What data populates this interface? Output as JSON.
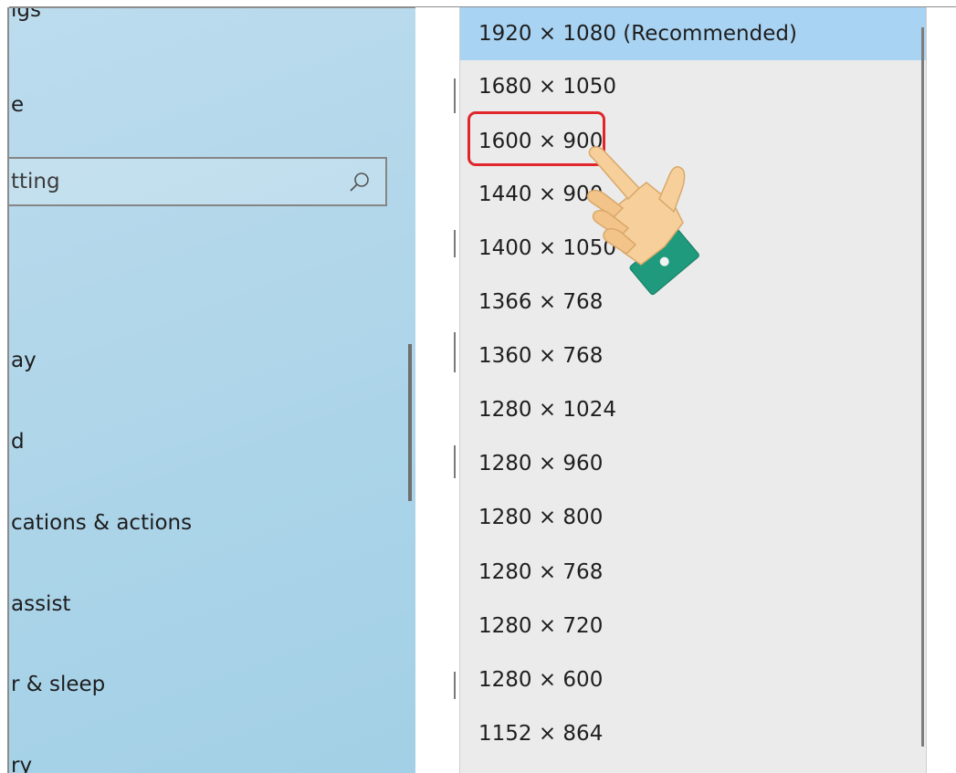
{
  "sidebar": {
    "top_partial": "ıgs",
    "item_partial_1": "e",
    "search": {
      "value": "tting"
    },
    "items": [
      {
        "label": "ay"
      },
      {
        "label": "d"
      },
      {
        "label": "cations & actions"
      },
      {
        "label": "assist"
      },
      {
        "label": "r & sleep"
      },
      {
        "label": "ry"
      }
    ]
  },
  "dropdown": {
    "options": [
      {
        "label": "1920 × 1080 (Recommended)",
        "selected": true
      },
      {
        "label": "1680 × 1050"
      },
      {
        "label": "1600 × 900",
        "highlighted": true
      },
      {
        "label": "1440 × 900"
      },
      {
        "label": "1400 × 1050"
      },
      {
        "label": "1366 × 768"
      },
      {
        "label": "1360 × 768"
      },
      {
        "label": "1280 × 1024"
      },
      {
        "label": "1280 × 960"
      },
      {
        "label": "1280 × 800"
      },
      {
        "label": "1280 × 768"
      },
      {
        "label": "1280 × 720"
      },
      {
        "label": "1280 × 600"
      },
      {
        "label": "1152 × 864"
      }
    ]
  },
  "colors": {
    "selected_bg": "#a9d3f2",
    "highlight_border": "#e0262b",
    "sidebar_bg": "#b3d7ea"
  },
  "icons": {
    "search": "search-icon",
    "pointer": "pointing-hand-icon"
  }
}
